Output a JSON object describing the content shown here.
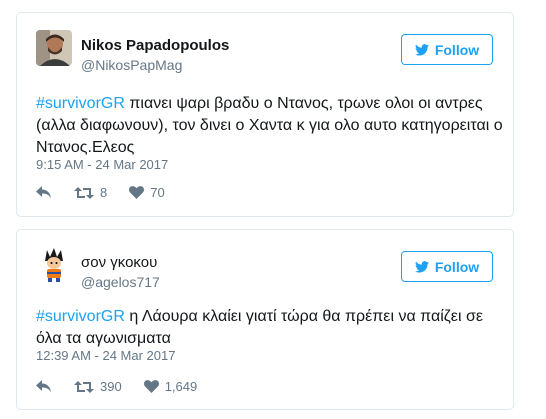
{
  "follow_label": "Follow",
  "colors": {
    "accent": "#1da1f2",
    "muted": "#657786",
    "border": "#e1e8ed"
  },
  "tweets": [
    {
      "name": "Nikos Papadopoulos",
      "handle": "@NikosPapMag",
      "hashtag": "#survivorGR",
      "text": " πιανει ψαρι βραδυ ο Ντανος, τρωνε ολοι οι αντρες (αλλα διαφωνουν), τον δινει ο Χαντα κ για ολο αυτο κατηγορειται ο Ντανος.Ελεος",
      "time": "9:15 AM - 24 Mar 2017",
      "retweets": "8",
      "likes": "70"
    },
    {
      "name": "σον γκοκου",
      "handle": "@agelos717",
      "hashtag": "#survivorGR",
      "text": " η Λάουρα κλαίει γιατί τώρα θα πρέπει να παίζει σε όλα τα αγωνισματα",
      "time": "12:39 AM - 24 Mar 2017",
      "retweets": "390",
      "likes": "1,649"
    }
  ]
}
